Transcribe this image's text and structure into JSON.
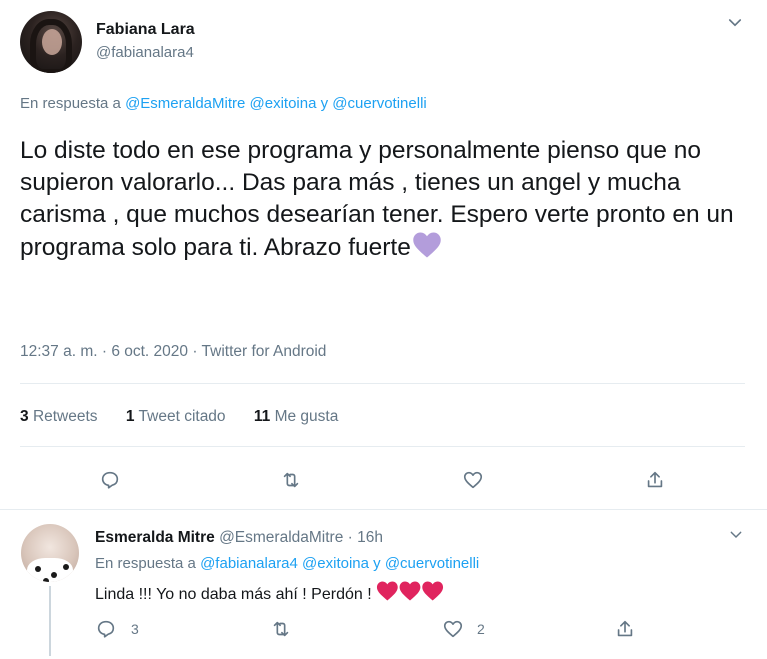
{
  "tweet": {
    "author_name": "Fabiana Lara",
    "author_handle": "@fabianalara4",
    "reply_prefix": "En respuesta a",
    "reply_mention_1": "@EsmeraldaMitre",
    "reply_mention_2": "@exitoina",
    "reply_joiner": "y",
    "reply_mention_3": "@cuervotinelli",
    "text": "Lo diste todo en ese programa y personalmente pienso que no supieron valorarlo... Das para más , tienes un angel y mucha carisma , que muchos desearían tener. Espero verte pronto en un programa solo para ti. Abrazo fuerte",
    "emoji": "purple-heart",
    "timestamp": "12:37 a. m. · 6 oct. 2020 · Twitter for Android",
    "stats": {
      "retweets_count": "3",
      "retweets_label": "Retweets",
      "quotes_count": "1",
      "quotes_label": "Tweet citado",
      "likes_count": "11",
      "likes_label": "Me gusta"
    }
  },
  "reply": {
    "author_name": "Esmeralda Mitre",
    "author_handle": "@EsmeraldaMitre",
    "time_sep": "·",
    "time": "16h",
    "reply_prefix": "En respuesta a",
    "reply_mention_1": "@fabianalara4",
    "reply_mention_2": "@exitoina",
    "reply_joiner": "y",
    "reply_mention_3": "@cuervotinelli",
    "text": "Linda !!! Yo no daba más ahí ! Perdón !",
    "emoji": "red-heart x3",
    "reply_count": "3",
    "like_count": "2"
  },
  "colors": {
    "link": "#1da1f2",
    "secondary_text": "#657786",
    "primary_text": "#14171a",
    "divider": "#e6ecf0",
    "purple_heart": "#b39ddb",
    "red_heart": "#e0245e"
  }
}
